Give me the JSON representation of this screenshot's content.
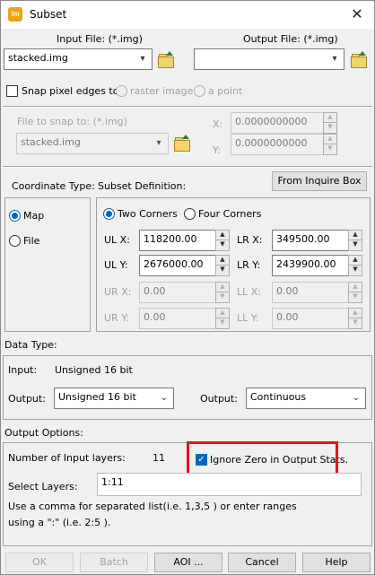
{
  "window": {
    "title": "Subset",
    "app_icon_text": "Im",
    "close_glyph": "✕"
  },
  "input_file": {
    "label": "Input File: (*.img)",
    "value": "stacked.img"
  },
  "output_file": {
    "label": "Output File: (*.img)",
    "value": ""
  },
  "snap": {
    "checkbox_label": "Snap pixel edges to",
    "checked": false,
    "radio_raster": "raster image",
    "radio_point": "a point",
    "file_label": "File to snap to: (*.img)",
    "file_value": "stacked.img",
    "x_label": "X:",
    "y_label": "Y:",
    "x_value": "0.0000000000",
    "y_value": "0.0000000000"
  },
  "coordinate_type": {
    "label": "Coordinate Type:",
    "map": "Map",
    "file": "File",
    "selected": "Map"
  },
  "subset_definition": {
    "label": "Subset Definition:",
    "from_inquire_box": "From Inquire Box",
    "two_corners": "Two Corners",
    "four_corners": "Four Corners",
    "selected": "Two Corners",
    "ul_x_label": "UL X:",
    "ul_x": "118200.00",
    "lr_x_label": "LR X:",
    "lr_x": "349500.00",
    "ul_y_label": "UL Y:",
    "ul_y": "2676000.00",
    "lr_y_label": "LR Y:",
    "lr_y": "2439900.00",
    "ur_x_label": "UR X:",
    "ur_x": "0.00",
    "ll_x_label": "LL X:",
    "ll_x": "0.00",
    "ur_y_label": "UR Y:",
    "ur_y": "0.00",
    "ll_y_label": "LL Y:",
    "ll_y": "0.00"
  },
  "data_type": {
    "label": "Data Type:",
    "input_label": "Input:",
    "input_value": "Unsigned 16 bit",
    "output_label": "Output:",
    "output_value": "Unsigned 16 bit",
    "output2_label": "Output:",
    "output2_value": "Continuous"
  },
  "output_options": {
    "label": "Output Options:",
    "num_layers_label": "Number of Input layers:",
    "num_layers_value": "11",
    "ignore_zero_label": "Ignore Zero in Output Stats.",
    "ignore_zero_checked": true,
    "select_layers_label": "Select Layers:",
    "select_layers_value": "1:11",
    "hint_line1": "Use a comma for separated list(i.e. 1,3,5 ) or enter ranges",
    "hint_line2": "using a \":\" (i.e. 2:5 ).",
    "highlight_color": "#e8141b"
  },
  "buttons": {
    "ok": "OK",
    "batch": "Batch",
    "aoi": "AOI ...",
    "cancel": "Cancel",
    "help": "Help"
  }
}
